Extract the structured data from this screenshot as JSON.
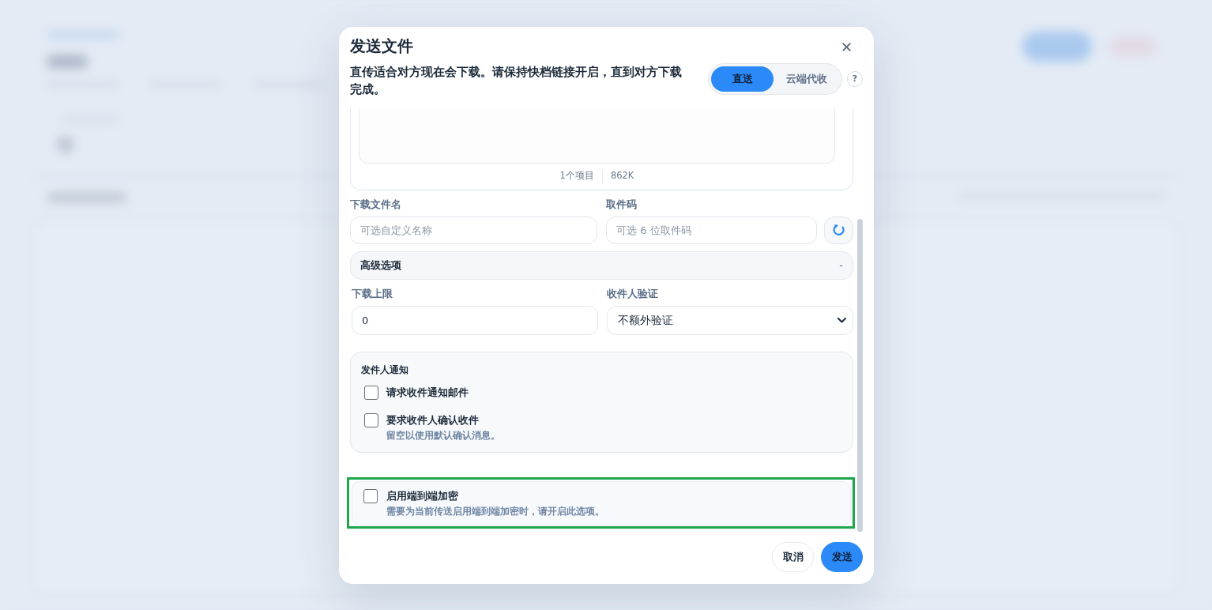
{
  "dialog": {
    "title": "发送文件",
    "description": "直传适合对方现在会下载。请保持快档链接开启，直到对方下载完成。"
  },
  "mode_toggle": [
    {
      "label": "直送",
      "selected": true
    },
    {
      "label": "云端代收",
      "selected": false
    }
  ],
  "help_button": "?",
  "file_summary": {
    "item_count": "1个项目",
    "total_size": "862K"
  },
  "download_name": {
    "label": "下载文件名",
    "placeholder": "可选自定义名称"
  },
  "pickup_code": {
    "label": "取件码",
    "placeholder": "可选 6 位取件码"
  },
  "advanced_options": {
    "label": "高级选项",
    "toggle": "-",
    "expanded": true
  },
  "download_limit": {
    "label": "下载上限",
    "value": "0"
  },
  "recipient_verification": {
    "label": "收件人验证",
    "value": "不额外验证"
  },
  "sender_notification": {
    "title": "发件人通知",
    "options": [
      {
        "label": "请求收件通知邮件",
        "checked": false
      },
      {
        "label": "要求收件人确认收件",
        "checked": false,
        "hint": "留空以使用默认确认消息。"
      }
    ]
  },
  "encryption": {
    "label": "启用端到端加密",
    "hint": "需要为当前传送启用端到端加密时，请开启此选项。",
    "checked": false,
    "highlighted": true
  },
  "buttons": [
    {
      "label": "取消",
      "kind": "secondary"
    },
    {
      "label": "发送",
      "kind": "primary"
    }
  ]
}
